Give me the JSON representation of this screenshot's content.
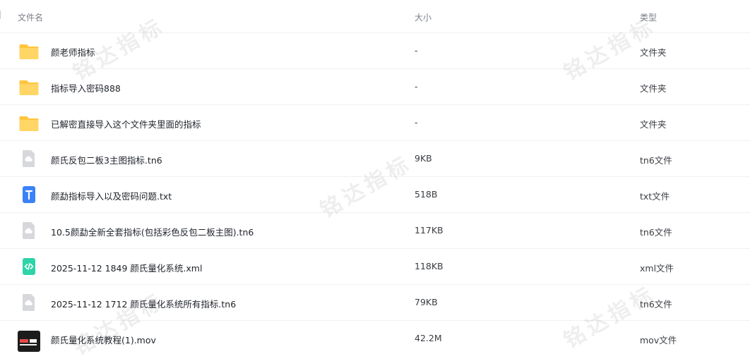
{
  "header": {
    "name": "文件名",
    "size": "大小",
    "type": "类型"
  },
  "files": [
    {
      "icon": "folder-icon",
      "name": "颜老师指标",
      "size": "-",
      "type": "文件夹"
    },
    {
      "icon": "folder-icon",
      "name": "指标导入密码888",
      "size": "-",
      "type": "文件夹"
    },
    {
      "icon": "folder-icon",
      "name": "已解密直接导入这个文件夹里面的指标",
      "size": "-",
      "type": "文件夹"
    },
    {
      "icon": "cloud-file-icon",
      "name": "颜氏反包二板3主图指标.tn6",
      "size": "9KB",
      "type": "tn6文件"
    },
    {
      "icon": "text-file-icon",
      "name": "颜勐指标导入以及密码问题.txt",
      "size": "518B",
      "type": "txt文件"
    },
    {
      "icon": "cloud-file-icon",
      "name": "10.5颜勐全新全套指标(包括彩色反包二板主图).tn6",
      "size": "117KB",
      "type": "tn6文件"
    },
    {
      "icon": "code-file-icon",
      "name": "2025-11-12 1849 颜氏量化系统.xml",
      "size": "118KB",
      "type": "xml文件"
    },
    {
      "icon": "cloud-file-icon",
      "name": "2025-11-12 1712 颜氏量化系统所有指标.tn6",
      "size": "79KB",
      "type": "tn6文件"
    },
    {
      "icon": "video-thumbnail",
      "name": "颜氏量化系统教程(1).mov",
      "size": "42.2M",
      "type": "mov文件"
    }
  ],
  "watermark": "铭达指标",
  "colors": {
    "folder": "#ffc53d",
    "text_icon": "#3b82f6",
    "code_icon": "#2dd4a7",
    "cloud_icon": "#d6d8dc"
  }
}
